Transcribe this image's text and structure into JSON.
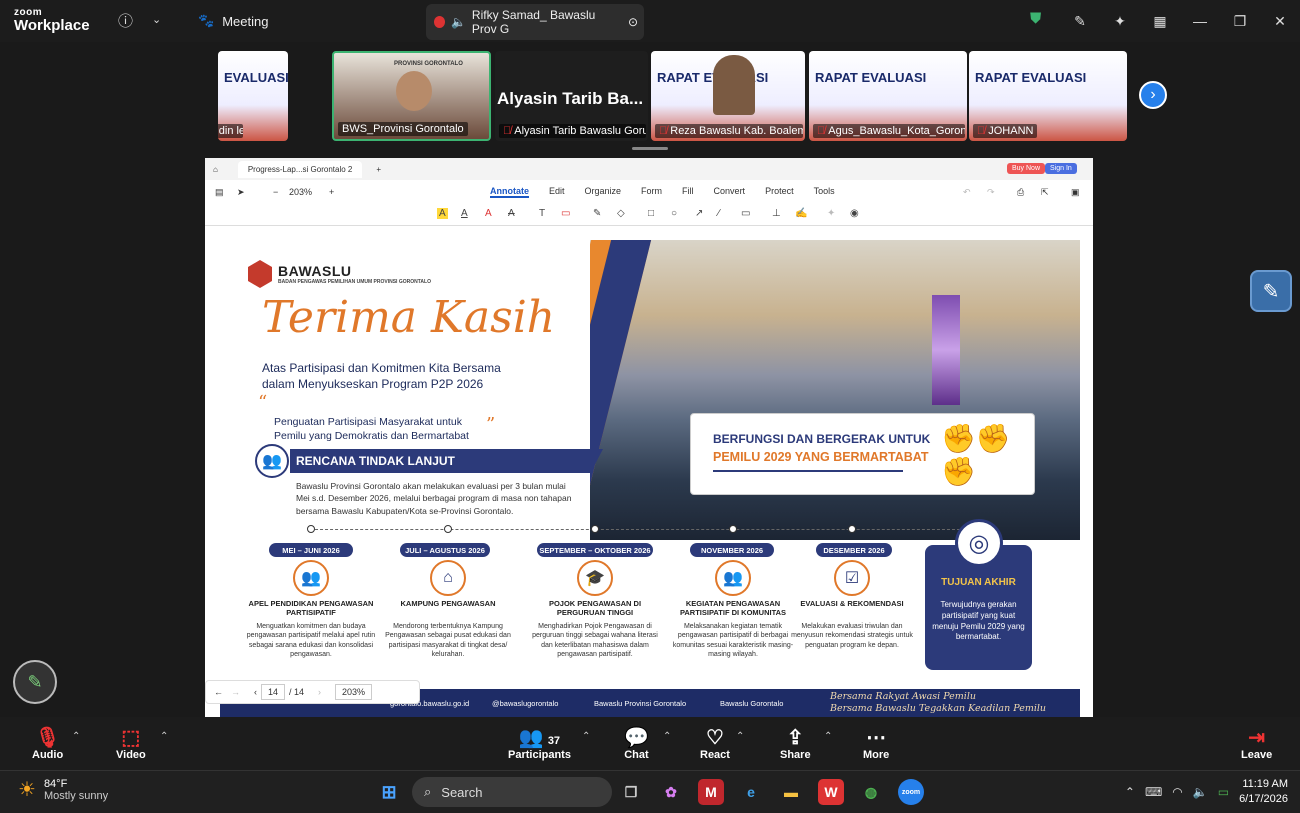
{
  "app": {
    "logo_line1": "zoom",
    "logo_line2": "Workplace",
    "meeting_label": "Meeting"
  },
  "speaker_tab": {
    "label": "Rifky Samad_ Bawaslu Prov G"
  },
  "thumbnails": [
    {
      "name": "amirudin lee",
      "slide_text": "EVALUASI"
    },
    {
      "name": "BWS_Provinsi Gorontalo",
      "caption": "PROVINSI GORONTALO"
    },
    {
      "name": "Alyasin Tarib Bawaslu Gorut",
      "big_name": "Alyasin Tarib Ba..."
    },
    {
      "name": "Reza Bawaslu Kab. Boalemo",
      "slide_text": "RAPAT EVALUASI"
    },
    {
      "name": "Agus_Bawaslu_Kota_Goron...",
      "slide_text": "RAPAT EVALUASI"
    },
    {
      "name": "JOHANN",
      "slide_text": "RAPAT EVALUASI"
    }
  ],
  "pdf": {
    "tab_title": "Progress-Lap...si Gorontalo 2",
    "zoom": "203%",
    "menu": [
      "Annotate",
      "Edit",
      "Organize",
      "Form",
      "Fill",
      "Convert",
      "Protect",
      "Tools"
    ],
    "buy_now": "Buy Now",
    "sign_in": "Sign In",
    "page_current": "14",
    "page_total": "/ 14",
    "pager_zoom": "203%"
  },
  "doc": {
    "brand": "BAWASLU",
    "brand_sub": "BADAN PENGAWAS PEMILIHAN UMUM PROVINSI GORONTALO",
    "terima": "Terima Kasih",
    "subtitle1": "Atas Partisipasi dan Komitmen Kita Bersama",
    "subtitle2": "dalam Menyukseskan Program P2P 2026",
    "quote1": "Penguatan Partisipasi Masyarakat untuk",
    "quote2": "Pemilu yang Demokratis dan Bermartabat",
    "rtl_title": "RENCANA TINDAK LANJUT",
    "rtl_desc1": "Bawaslu Provinsi Gorontalo akan melakukan evaluasi per 3 bulan mulai",
    "rtl_desc2": "Mei s.d. Desember 2026, melalui berbagai program di masa non tahapan",
    "rtl_desc3": "bersama Bawaslu Kabupaten/Kota se-Provinsi Gorontalo.",
    "bf_line1": "BERFUNGSI DAN BERGERAK UNTUK",
    "bf_line2": "PEMILU 2029 YANG BERMARTABAT",
    "timeline": [
      {
        "date": "MEI – JUNI 2026",
        "title": "APEL PENDIDIKAN PENGAWASAN PARTISIPATIF",
        "desc": "Menguatkan komitmen dan budaya pengawasan partisipatif melalui apel rutin sebagai sarana edukasi dan konsolidasi pengawasan."
      },
      {
        "date": "JULI – AGUSTUS 2026",
        "title": "KAMPUNG PENGAWASAN",
        "desc": "Mendorong terbentuknya Kampung Pengawasan sebagai pusat edukasi dan partisipasi masyarakat di tingkat desa/ kelurahan."
      },
      {
        "date": "SEPTEMBER – OKTOBER 2026",
        "title": "POJOK PENGAWASAN DI PERGURUAN TINGGI",
        "desc": "Menghadirkan Pojok Pengawasan di perguruan tinggi sebagai wahana literasi dan keterlibatan mahasiswa dalam pengawasan partisipatif."
      },
      {
        "date": "NOVEMBER 2026",
        "title": "KEGIATAN PENGAWASAN PARTISIPATIF DI KOMUNITAS",
        "desc": "Melaksanakan kegiatan tematik pengawasan partisipatif di berbagai komunitas sesuai karakteristik masing-masing wilayah."
      },
      {
        "date": "DESEMBER 2026",
        "title": "EVALUASI & REKOMENDASI",
        "desc": "Melakukan evaluasi triwulan dan menyusun rekomendasi strategis untuk penguatan program ke depan."
      }
    ],
    "tujuan_title": "TUJUAN AKHIR",
    "tujuan_desc": "Terwujudnya gerakan partisipatif yang kuat menuju Pemilu 2029 yang bermartabat.",
    "footer_web": "gorontalo.bawaslu.go.id",
    "footer_ig": "@bawaslugorontalo",
    "footer_fb": "Bawaslu Provinsi Gorontalo",
    "footer_yt": "Bawaslu Gorontalo",
    "tag1": "Bersama Rakyat Awasi Pemilu",
    "tag2": "Bersama Bawaslu Tegakkan Keadilan Pemilu"
  },
  "bottombar": {
    "audio": "Audio",
    "video": "Video",
    "participants": "Participants",
    "participants_count": "37",
    "chat": "Chat",
    "react": "React",
    "share": "Share",
    "more": "More",
    "leave": "Leave"
  },
  "taskbar": {
    "temp": "84°F",
    "weather": "Mostly sunny",
    "search": "Search",
    "time": "11:19 AM",
    "date": "6/17/2026"
  },
  "colors": {
    "accent_orange": "#e0782a",
    "navy": "#2c3a7a",
    "zoom_blue": "#2680eb",
    "active_green": "#3cb371"
  }
}
